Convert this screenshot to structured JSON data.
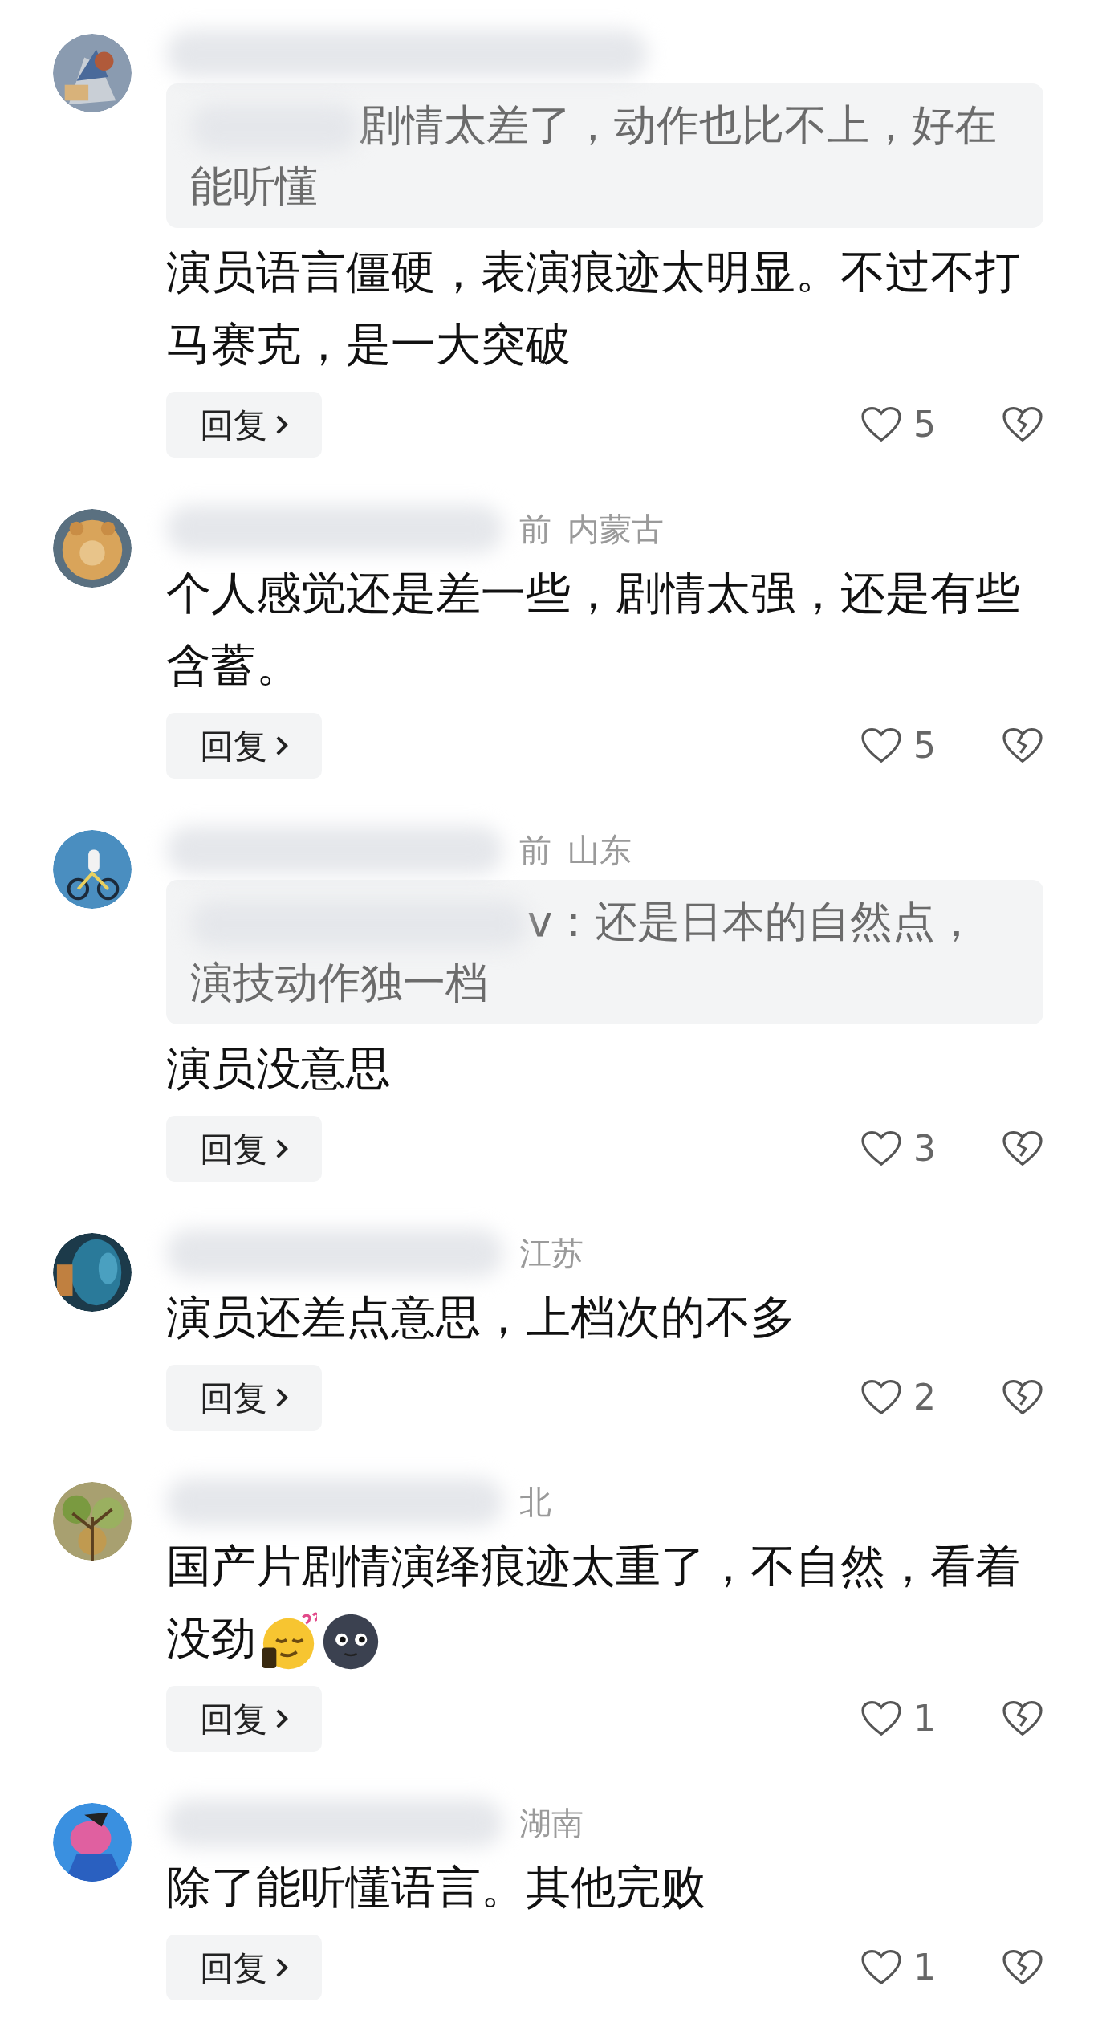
{
  "comments": [
    {
      "quote": "剧情太差了，动作也比不上，好在能听懂",
      "text": "演员语言僵硬，表演痕迹太明显。不过不打马赛克，是一大突破",
      "reply": "回复",
      "likes": "5"
    },
    {
      "meta": "前",
      "region": "内蒙古",
      "text": "个人感觉还是差一些，剧情太强，还是有些含蓄。",
      "reply": "回复",
      "likes": "5"
    },
    {
      "meta": "前",
      "region": "山东",
      "quote": "v：还是日本的自然点，演技动作独一档",
      "text": "演员没意思",
      "reply": "回复",
      "likes": "3"
    },
    {
      "region": "江苏",
      "text": "演员还差点意思，上档次的不多",
      "reply": "回复",
      "likes": "2"
    },
    {
      "region": "北",
      "text": "国产片剧情演绎痕迹太重了，不自然，看着没劲",
      "emojis": [
        {
          "kind": "sleepy"
        },
        {
          "kind": "moon"
        }
      ],
      "reply": "回复",
      "likes": "1"
    },
    {
      "region": "湖南",
      "text": "除了能听懂语言。其他完败",
      "reply": "回复",
      "likes": "1"
    }
  ]
}
